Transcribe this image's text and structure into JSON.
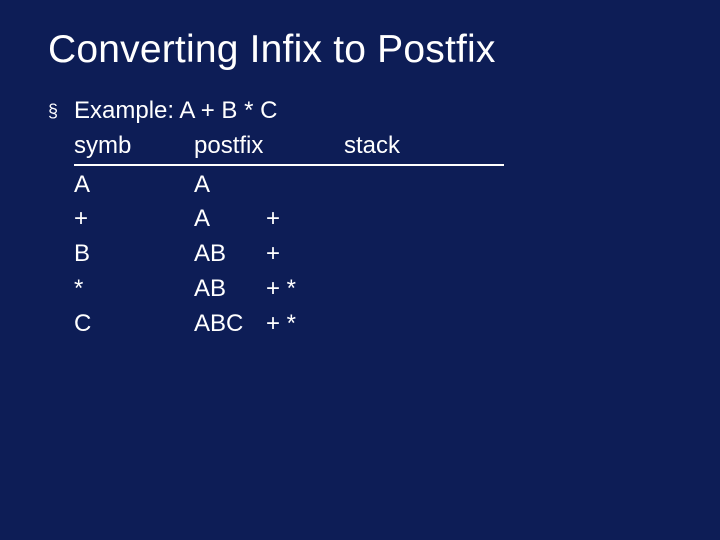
{
  "title": "Converting Infix to Postfix",
  "bullet_glyph": "§",
  "example_label": "Example: A + B * C",
  "headers": {
    "symb": "symb",
    "postfix": "postfix",
    "stack": "stack"
  },
  "rows": [
    {
      "symb": "A",
      "postfix": "A",
      "stack": ""
    },
    {
      "symb": "+",
      "postfix": "A",
      "stack": "+"
    },
    {
      "symb": "B",
      "postfix": "AB",
      "stack": "+"
    },
    {
      "symb": "*",
      "postfix": "AB",
      "stack": "+ *"
    },
    {
      "symb": "C",
      "postfix": "ABC",
      "stack": "+ *"
    }
  ]
}
